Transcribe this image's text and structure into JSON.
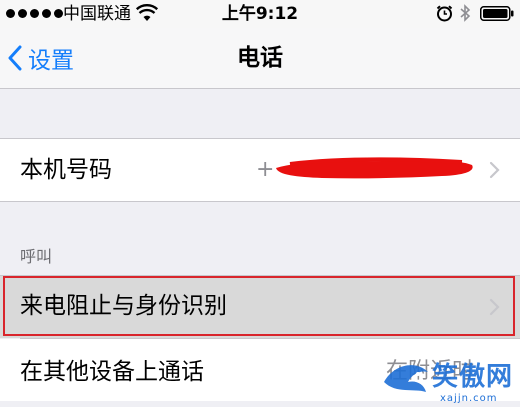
{
  "status_bar": {
    "carrier": "中国联通",
    "time": "上午9:12",
    "icons": [
      "signal-icon",
      "wifi-icon",
      "alarm-icon",
      "bluetooth-icon",
      "battery-icon"
    ]
  },
  "nav": {
    "back_label": "设置",
    "title": "电话"
  },
  "cells": {
    "my_number": {
      "label": "本机号码",
      "value_prefix": "+"
    },
    "section_calls": "呼叫",
    "call_blocking": {
      "label": "来电阻止与身份识别"
    },
    "other_devices": {
      "label": "在其他设备上通话",
      "value": "在附近时"
    }
  },
  "watermark": {
    "text": "笑傲网",
    "url": "xajjn.com"
  },
  "colors": {
    "accent": "#147efb",
    "highlight_border": "#d9252c",
    "background": "#efeff4"
  }
}
